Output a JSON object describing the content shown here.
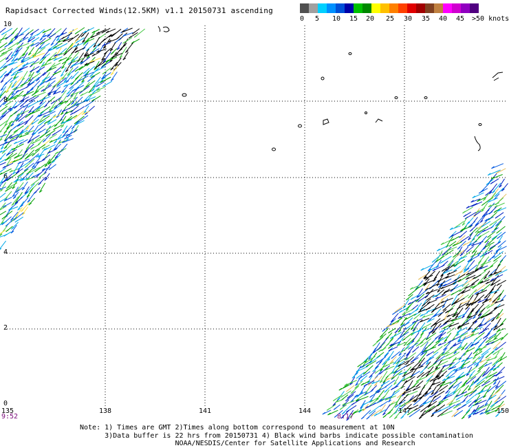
{
  "title": "Rapidsact Corrected Winds(12.5KM) v1.1 20150731 ascending",
  "colorbar": {
    "colors": [
      "#505050",
      "#a0a0a0",
      "#00d0ff",
      "#0090ff",
      "#0050d8",
      "#0000a8",
      "#00c000",
      "#008800",
      "#ffff00",
      "#ffc000",
      "#ff8000",
      "#ff4000",
      "#e00000",
      "#a00000",
      "#804020",
      "#c08040",
      "#ff00ff",
      "#d000d0",
      "#9000c0",
      "#500080"
    ],
    "labels": [
      "0",
      "5",
      "10",
      "15",
      "20",
      "25",
      "30",
      "35",
      "40",
      "45",
      ">50 knots"
    ]
  },
  "axes": {
    "y_labels": [
      "10",
      "8",
      "6",
      "4",
      "2",
      "0"
    ],
    "x_labels": [
      "135",
      "138",
      "141",
      "144",
      "147",
      "150"
    ]
  },
  "times": [
    "9:52",
    "8:17"
  ],
  "notes": [
    "Note: 1) Times are GMT 2)Times along bottom correspond to measurement at 10N",
    "      3)Data buffer is 22 hrs from 20150731 4) Black wind barbs indicate possible contamination",
    "                       NOAA/NESDIS/Center for Satellite Applications and Research"
  ],
  "legend_colors": {
    "wind_speed_palette": [
      "#00a8e8",
      "#0058e0",
      "#0020c0",
      "#00a000",
      "#44c844",
      "#ffe040",
      "#e8c060"
    ],
    "contamination": "#000000"
  }
}
